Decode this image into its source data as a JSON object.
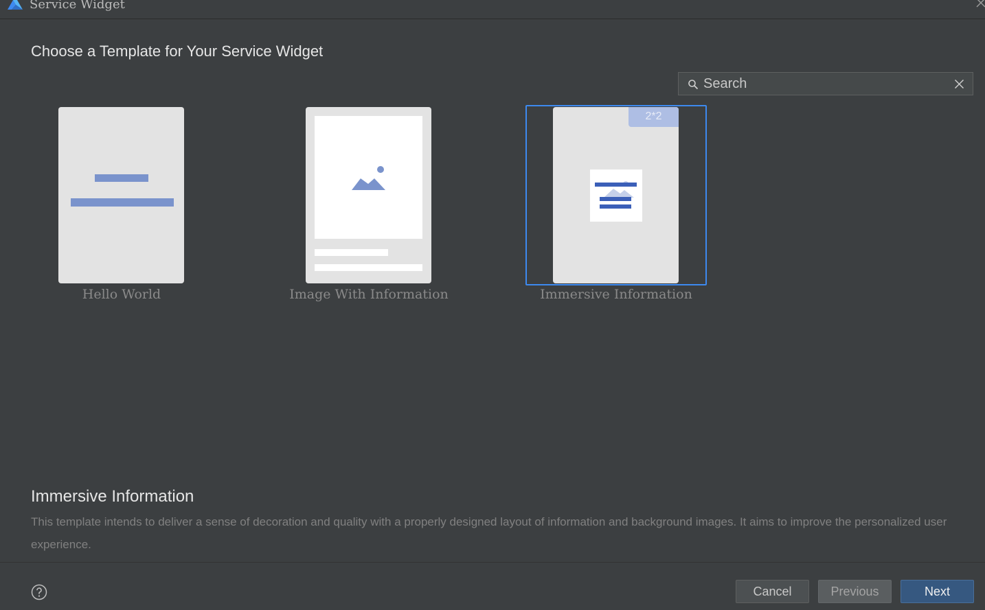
{
  "window": {
    "title": "Service Widget"
  },
  "page": {
    "title": "Choose a Template for Your Service Widget"
  },
  "search": {
    "placeholder": "Search",
    "value": ""
  },
  "templates": [
    {
      "label": "Hello World",
      "selected": false
    },
    {
      "label": "Image With Information",
      "selected": false
    },
    {
      "label": "Immersive Information",
      "selected": true,
      "size_badge": "2*2"
    }
  ],
  "description": {
    "title": "Immersive Information",
    "text": "This template intends to deliver a sense of decoration and quality with a properly designed layout of information and background images. It aims to improve the personalized user experience."
  },
  "footer": {
    "cancel_label": "Cancel",
    "previous_label": "Previous",
    "next_label": "Next"
  },
  "colors": {
    "background": "#3c3f41",
    "selection": "#3d8af0",
    "illustration_blue": "#7a93cc",
    "next_button": "#365880"
  },
  "icons": {
    "logo": "app-logo-icon",
    "close": "close-icon",
    "search": "search-icon",
    "clear": "clear-icon",
    "help": "help-icon"
  }
}
